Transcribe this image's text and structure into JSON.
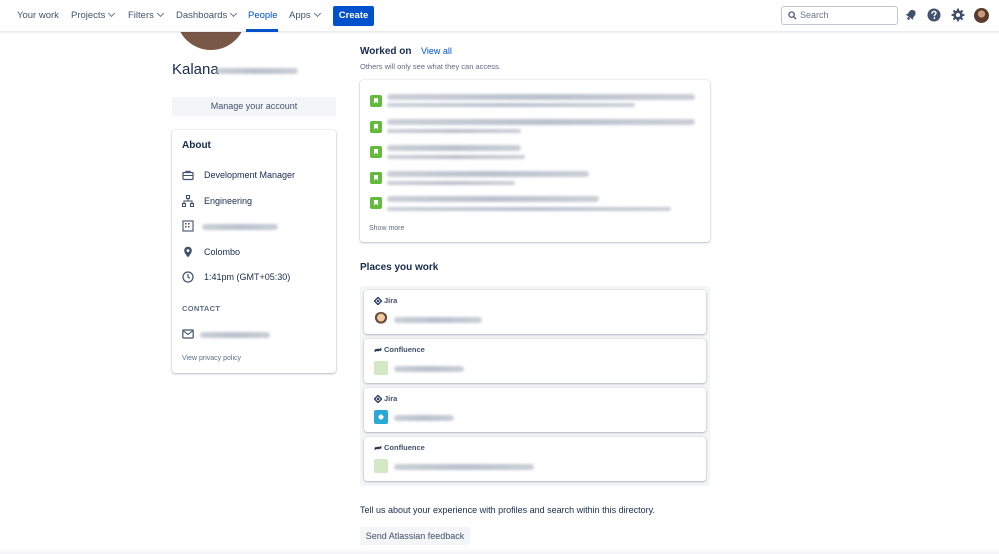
{
  "nav": {
    "items": [
      {
        "label": "Your work",
        "dropdown": false
      },
      {
        "label": "Projects",
        "dropdown": true
      },
      {
        "label": "Filters",
        "dropdown": true
      },
      {
        "label": "Dashboards",
        "dropdown": true
      },
      {
        "label": "People",
        "dropdown": false,
        "active": true
      },
      {
        "label": "Apps",
        "dropdown": true
      }
    ],
    "create_label": "Create",
    "search_placeholder": "Search",
    "icons": [
      "notifications-icon",
      "help-icon",
      "settings-icon",
      "user-avatar"
    ]
  },
  "profile": {
    "name": "Kalana",
    "manage_label": "Manage your account"
  },
  "about": {
    "title": "About",
    "job_title": "Development Manager",
    "department": "Engineering",
    "organization": "",
    "location": "Colombo",
    "local_time": "1:41pm (GMT+05:30)",
    "contact_label": "CONTACT",
    "email": "",
    "privacy_link": "View privacy policy"
  },
  "worked_on": {
    "title": "Worked on",
    "view_all": "View all",
    "subtitle": "Others will only see what they can access.",
    "items_count": 5,
    "show_more": "Show more"
  },
  "places": {
    "title": "Places you work",
    "items": [
      {
        "product": "Jira"
      },
      {
        "product": "Confluence"
      },
      {
        "product": "Jira"
      },
      {
        "product": "Confluence"
      }
    ]
  },
  "feedback": {
    "text": "Tell us about your experience with profiles and search within this directory.",
    "button": "Send Atlassian feedback"
  },
  "colors": {
    "brand_blue": "#0052cc",
    "story_green": "#63ba3c",
    "text_dark": "#172b4d",
    "text_subtle": "#5e6c84"
  }
}
